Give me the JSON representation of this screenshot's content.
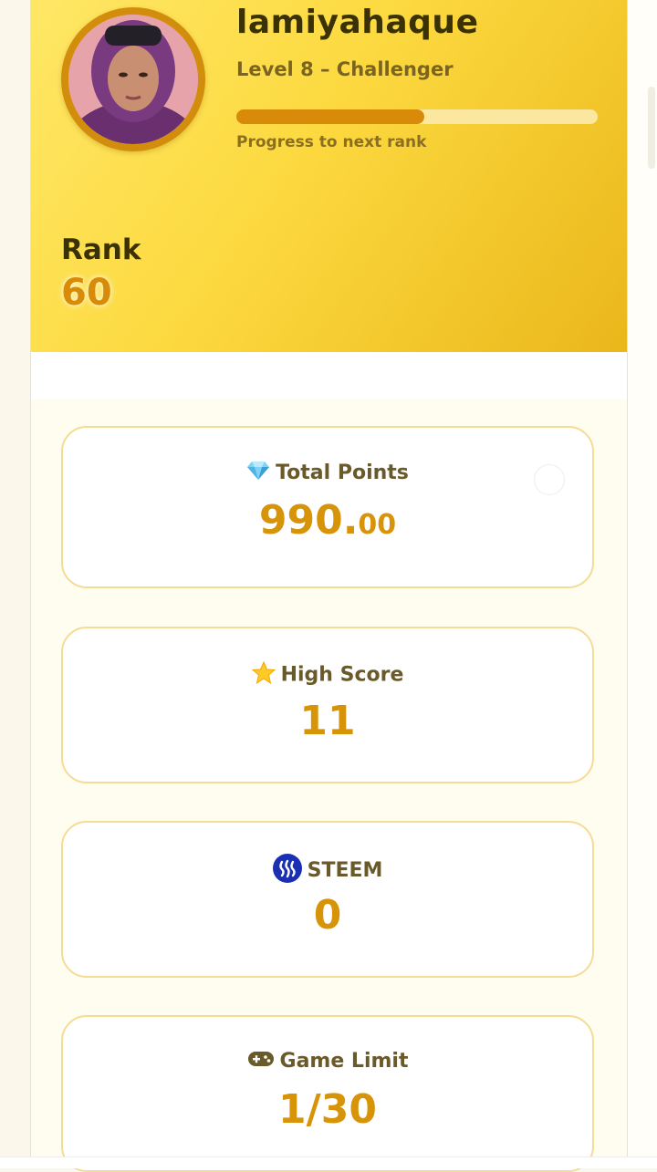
{
  "profile": {
    "username": "lamiyahaque",
    "level": "Level 8 – Challenger",
    "progress_fraction": 0.52,
    "progress_label": "Progress to next rank",
    "rank_label": "Rank",
    "rank_value": "60"
  },
  "stats": {
    "total_points": {
      "icon": "gem-icon",
      "label": "Total Points",
      "value_main": "990.",
      "value_decimal": "00"
    },
    "high_score": {
      "icon": "star-icon",
      "label": "High Score",
      "value": "11"
    },
    "steem": {
      "icon": "steem-logo-icon",
      "label": "STEEM",
      "value": "0"
    },
    "game_limit": {
      "icon": "gamepad-icon",
      "label": "Game Limit",
      "value": "1/30"
    }
  },
  "colors": {
    "accent": "#d88a09",
    "value_gold": "#d89408",
    "header_start": "#ffe766",
    "header_end": "#eab71b"
  }
}
